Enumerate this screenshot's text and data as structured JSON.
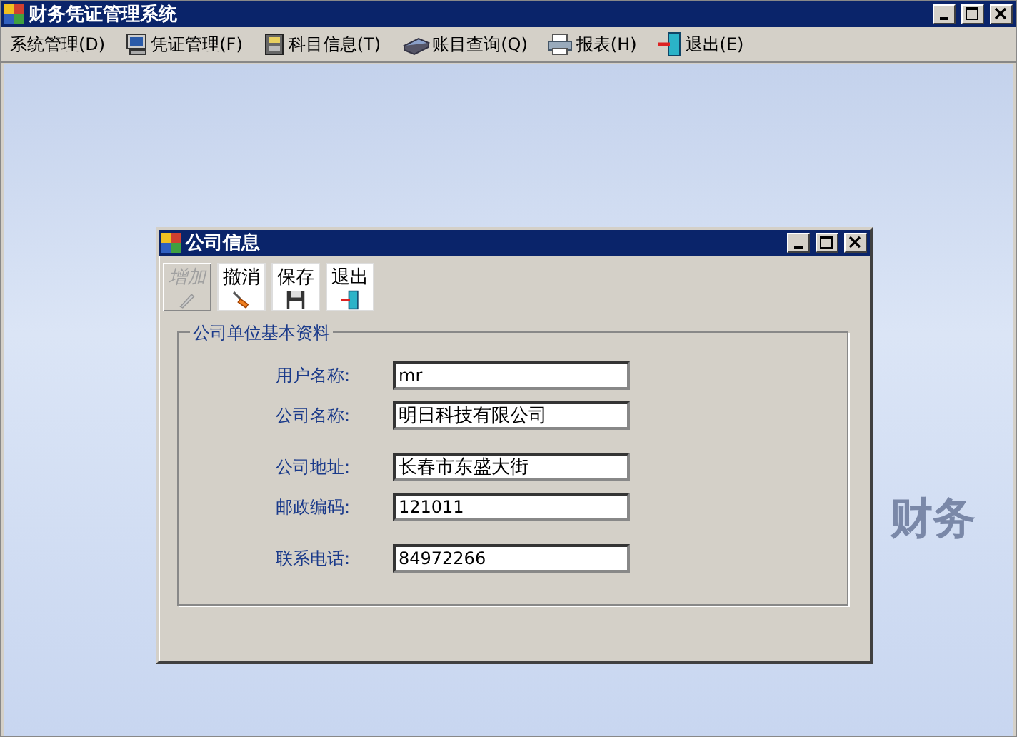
{
  "window": {
    "title": "财务凭证管理系统"
  },
  "menu": [
    {
      "label": "系统管理(D)",
      "kind": "plain"
    },
    {
      "label": "凭证管理(F)",
      "kind": "monitor"
    },
    {
      "label": "科目信息(T)",
      "kind": "ledger"
    },
    {
      "label": "账目查询(Q)",
      "kind": "scanner"
    },
    {
      "label": "报表(H)",
      "kind": "printer"
    },
    {
      "label": "退出(E)",
      "kind": "door"
    }
  ],
  "background_text": "财务",
  "form": {
    "title": "公司信息",
    "toolbar": [
      {
        "label": "增加",
        "kind": "pencil",
        "disabled": true
      },
      {
        "label": "撤消",
        "kind": "brush",
        "disabled": false
      },
      {
        "label": "保存",
        "kind": "floppy",
        "disabled": false
      },
      {
        "label": "退出",
        "kind": "door",
        "disabled": false
      }
    ],
    "group_title": "公司单位基本资料",
    "fields": [
      {
        "label": "用户名称:",
        "value": "mr"
      },
      {
        "label": "公司名称:",
        "value": "明日科技有限公司"
      },
      {
        "label": "公司地址:",
        "value": "长春市东盛大街"
      },
      {
        "label": "邮政编码:",
        "value": "121011"
      },
      {
        "label": "联系电话:",
        "value": "84972266"
      }
    ]
  }
}
